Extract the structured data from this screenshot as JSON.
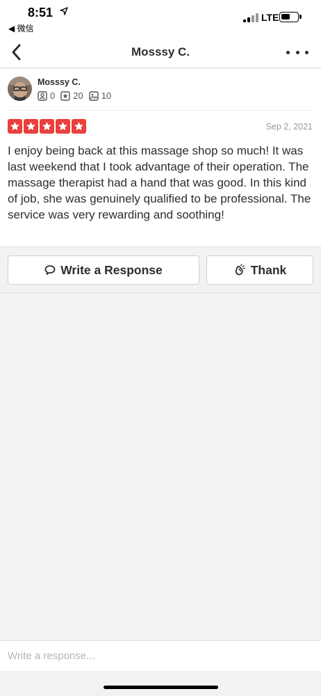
{
  "status_bar": {
    "time": "8:51",
    "back_app": "◀ 微信",
    "network": "LTE"
  },
  "nav": {
    "title": "Mosssy C."
  },
  "review": {
    "user_name": "Mosssy C.",
    "stats": {
      "friends": "0",
      "reviews": "20",
      "photos": "10"
    },
    "rating": 5,
    "date": "Sep 2, 2021",
    "text": "I enjoy being back at this massage shop so much! It was last weekend that I took advantage of their operation. The massage therapist had a hand that was good. In this kind of job, she was genuinely qualified to be professional. The service was very rewarding and soothing!"
  },
  "actions": {
    "respond_label": "Write a Response",
    "thank_label": "Thank"
  },
  "composer": {
    "placeholder": "Write a response..."
  },
  "colors": {
    "star_red": "#e8403c",
    "text_dark": "#2d2d2d",
    "background": "#f2f2f2"
  }
}
